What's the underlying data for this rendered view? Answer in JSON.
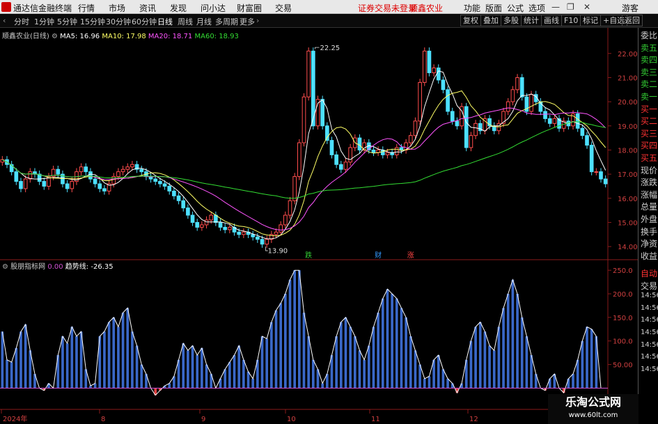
{
  "app": {
    "name": "通达信金融终端"
  },
  "menus": [
    "行情",
    "市场",
    "资讯",
    "发现",
    "问小达",
    "财富圈",
    "交易"
  ],
  "alert_text": "证券交易未登录",
  "current_stock": "顺鑫农业",
  "right_menus": [
    "功能",
    "版面",
    "公式",
    "选项"
  ],
  "user": "游客",
  "period_tabs": [
    "分时",
    "1分钟",
    "5分钟",
    "15分钟",
    "30分钟",
    "60分钟",
    "日线",
    "周线",
    "月线",
    "多周期",
    "更多"
  ],
  "active_period": "日线",
  "right_buttons": [
    "复权",
    "叠加",
    "多股",
    "统计",
    "画线",
    "F10",
    "标记",
    "+自选",
    "返回"
  ],
  "main_chart": {
    "title": "顺鑫农业(日线)",
    "ma": [
      {
        "label": "MA5: 16.96",
        "color": "#ffffff"
      },
      {
        "label": "MA10: 17.98",
        "color": "#ffff66"
      },
      {
        "label": "MA20: 18.71",
        "color": "#ff55ff"
      },
      {
        "label": "MA60: 18.93",
        "color": "#33dd33"
      }
    ],
    "y_ticks": [
      "22.00",
      "21.00",
      "20.00",
      "19.00",
      "18.00",
      "17.00",
      "16.00",
      "15.00",
      "14.00"
    ],
    "high_label": "22.25",
    "low_label": "13.90",
    "event_marks": [
      {
        "text": "跌",
        "color": "#33cc33"
      },
      {
        "text": "财",
        "color": "#3399ff"
      },
      {
        "text": "涨",
        "color": "#ff4444"
      }
    ]
  },
  "sub_chart": {
    "title": "股朋指标网",
    "value1": "0.00",
    "trend_label": "趋势线:",
    "trend_value": "-26.35",
    "y_ticks": [
      "250.0",
      "200.0",
      "150.0",
      "100.0",
      "50.00"
    ]
  },
  "x_ticks": [
    "2024年",
    "8",
    "9",
    "10",
    "11",
    "12"
  ],
  "side_labels": [
    "委比",
    "卖五",
    "卖四",
    "卖三",
    "卖二",
    "卖一",
    "买一",
    "买二",
    "买三",
    "买四",
    "买五",
    "现价",
    "涨跌",
    "涨幅",
    "总量",
    "外盘",
    "换手",
    "净资",
    "收益"
  ],
  "side_labels_lower": [
    "自动",
    "交易",
    "14:56",
    "14:56",
    "14:56",
    "14:56",
    "14:56",
    "14:56",
    "14:56"
  ],
  "watermark": {
    "line1": "乐淘公式网",
    "line2": "www.60lt.com"
  },
  "chart_data": {
    "type": "candlestick",
    "price_range": [
      13.6,
      22.6
    ],
    "closes": [
      17.6,
      17.4,
      17.1,
      16.7,
      16.4,
      16.8,
      17.1,
      17.0,
      16.7,
      16.5,
      16.9,
      17.2,
      17.0,
      16.6,
      16.4,
      16.7,
      17.1,
      17.3,
      17.1,
      16.8,
      16.6,
      16.4,
      16.3,
      16.6,
      16.9,
      17.1,
      17.2,
      17.3,
      17.4,
      17.2,
      17.1,
      16.9,
      16.8,
      16.7,
      16.6,
      16.5,
      16.3,
      16.1,
      15.9,
      15.6,
      15.3,
      15.0,
      14.8,
      14.9,
      15.1,
      15.3,
      15.0,
      14.8,
      14.7,
      14.8,
      14.6,
      14.5,
      14.6,
      14.5,
      14.4,
      14.3,
      14.1,
      14.3,
      14.5,
      14.6,
      14.9,
      15.3,
      15.9,
      16.9,
      18.3,
      20.2,
      22.1,
      19.0,
      20.1,
      19.0,
      18.4,
      17.8,
      17.4,
      17.2,
      17.5,
      18.1,
      18.5,
      18.0,
      18.3,
      18.0,
      17.9,
      18.0,
      17.8,
      17.9,
      17.8,
      18.1,
      18.0,
      18.3,
      18.6,
      19.2,
      20.8,
      22.1,
      21.2,
      21.4,
      20.9,
      20.5,
      19.6,
      19.2,
      19.0,
      19.8,
      18.1,
      18.6,
      19.1,
      18.8,
      19.3,
      19.0,
      18.8,
      19.1,
      19.6,
      20.0,
      20.5,
      21.0,
      20.2,
      19.6,
      20.3,
      20.0,
      19.6,
      19.3,
      19.1,
      19.3,
      18.9,
      19.2,
      19.0,
      19.5,
      18.9,
      18.6,
      18.2,
      17.1,
      17.1,
      16.8,
      16.6
    ],
    "osc_range": [
      -20,
      265
    ],
    "oscillator": [
      120,
      60,
      55,
      85,
      120,
      135,
      80,
      30,
      0,
      -5,
      10,
      0,
      70,
      110,
      95,
      130,
      110,
      120,
      40,
      5,
      10,
      110,
      120,
      140,
      150,
      130,
      160,
      170,
      120,
      90,
      50,
      30,
      0,
      -15,
      -5,
      5,
      10,
      25,
      60,
      95,
      80,
      90,
      70,
      85,
      50,
      30,
      0,
      20,
      40,
      55,
      70,
      90,
      60,
      35,
      20,
      60,
      110,
      105,
      140,
      165,
      180,
      200,
      230,
      250,
      250,
      160,
      110,
      60,
      40,
      10,
      30,
      70,
      110,
      140,
      150,
      130,
      110,
      80,
      60,
      90,
      130,
      160,
      190,
      210,
      200,
      190,
      170,
      150,
      110,
      80,
      50,
      20,
      25,
      60,
      70,
      40,
      20,
      10,
      -10,
      10,
      60,
      100,
      130,
      140,
      120,
      90,
      80,
      130,
      170,
      200,
      230,
      200,
      150,
      110,
      70,
      30,
      0,
      -5,
      20,
      30,
      0,
      -10,
      20,
      30,
      60,
      100,
      130,
      125,
      110,
      0,
      0
    ]
  }
}
